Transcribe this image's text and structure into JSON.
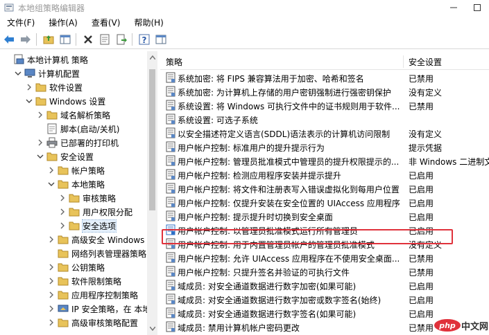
{
  "window": {
    "title": "本地组策略编辑器"
  },
  "menu": [
    "文件(F)",
    "操作(A)",
    "查看(V)",
    "帮助(H)"
  ],
  "toolbar_icons": [
    "back-arrow-icon",
    "forward-arrow-icon",
    "up-folder-icon",
    "show-tree-icon",
    "delete-icon",
    "properties-icon",
    "export-icon",
    "help-icon",
    "show-hide-pane-icon"
  ],
  "tree": [
    {
      "label": "本地计算机 策略",
      "icon": "policy-computer-icon",
      "level": 0,
      "expanded": null
    },
    {
      "label": "计算机配置",
      "icon": "computer-icon",
      "level": 1,
      "expanded": true
    },
    {
      "label": "软件设置",
      "icon": "folder-icon",
      "level": 2,
      "expanded": false
    },
    {
      "label": "Windows 设置",
      "icon": "folder-icon",
      "level": 2,
      "expanded": true
    },
    {
      "label": "域名解析策略",
      "icon": "folder-icon",
      "level": 3,
      "expanded": false
    },
    {
      "label": "脚本(启动/关机)",
      "icon": "script-icon",
      "level": 3,
      "expanded": null
    },
    {
      "label": "已部署的打印机",
      "icon": "printer-icon",
      "level": 3,
      "expanded": false
    },
    {
      "label": "安全设置",
      "icon": "folder-icon",
      "level": 3,
      "expanded": true
    },
    {
      "label": "帐户策略",
      "icon": "folder-icon",
      "level": 4,
      "expanded": false
    },
    {
      "label": "本地策略",
      "icon": "folder-icon",
      "level": 4,
      "expanded": true
    },
    {
      "label": "审核策略",
      "icon": "folder-icon",
      "level": 5,
      "expanded": false
    },
    {
      "label": "用户权限分配",
      "icon": "folder-icon",
      "level": 5,
      "expanded": false
    },
    {
      "label": "安全选项",
      "icon": "folder-icon",
      "level": 5,
      "expanded": false,
      "selected": true
    },
    {
      "label": "高级安全 Windows",
      "icon": "folder-icon",
      "level": 4,
      "expanded": false
    },
    {
      "label": "网络列表管理器策略",
      "icon": "folder-icon",
      "level": 4,
      "expanded": null
    },
    {
      "label": "公钥策略",
      "icon": "folder-icon",
      "level": 4,
      "expanded": false
    },
    {
      "label": "软件限制策略",
      "icon": "folder-icon",
      "level": 4,
      "expanded": false
    },
    {
      "label": "应用程序控制策略",
      "icon": "folder-icon",
      "level": 4,
      "expanded": false
    },
    {
      "label": "IP 安全策略，在 本地",
      "icon": "ip-security-icon",
      "level": 4,
      "expanded": false
    },
    {
      "label": "高级审核策略配置",
      "icon": "folder-icon",
      "level": 4,
      "expanded": false
    }
  ],
  "list": {
    "headers": {
      "policy": "策略",
      "setting": "安全设置"
    },
    "rows": [
      {
        "name": "系统加密: 将 FIPS 兼容算法用于加密、哈希和签名",
        "value": "已禁用"
      },
      {
        "name": "系统加密: 为计算机上存储的用户密钥强制进行强密钥保护",
        "value": "没有定义"
      },
      {
        "name": "系统设置: 将 Windows 可执行文件中的证书规则用于软件...",
        "value": "已禁用"
      },
      {
        "name": "系统设置: 可选子系统",
        "value": ""
      },
      {
        "name": "以安全描述符定义语言(SDDL)语法表示的计算机访问限制",
        "value": "没有定义"
      },
      {
        "name": "用户帐户控制: 标准用户的提升提示行为",
        "value": "提示凭据"
      },
      {
        "name": "用户帐户控制: 管理员批准模式中管理员的提升权限提示的...",
        "value": "非 Windows 二进制文"
      },
      {
        "name": "用户帐户控制: 检测应用程序安装并提示提升",
        "value": "已启用"
      },
      {
        "name": "用户帐户控制: 将文件和注册表写入错误虚拟化到每用户位置",
        "value": "已启用"
      },
      {
        "name": "用户帐户控制: 仅提升安装在安全位置的 UIAccess 应用程序",
        "value": "已启用"
      },
      {
        "name": "用户帐户控制: 提示提升时切换到安全桌面",
        "value": "已启用"
      },
      {
        "name": "用户帐户控制: 以管理员批准模式运行所有管理员",
        "value": "已启用",
        "highlighted": true
      },
      {
        "name": "用户帐户控制: 用于内置管理员帐户的管理员批准模式",
        "value": "没有定义"
      },
      {
        "name": "用户帐户控制: 允许 UIAccess 应用程序在不使用安全桌面...",
        "value": "已禁用"
      },
      {
        "name": "用户帐户控制: 只提升签名并验证的可执行文件",
        "value": "已禁用"
      },
      {
        "name": "域成员: 对安全通道数据进行数字加密(如果可能)",
        "value": "已启用"
      },
      {
        "name": "域成员: 对安全通道数据进行数字加密或数字签名(始终)",
        "value": "已启用"
      },
      {
        "name": "域成员: 对安全通道数据进行数字签名(如果可能)",
        "value": "已启用"
      },
      {
        "name": "域成员: 禁用计算机帐户密码更改",
        "value": "已禁用"
      }
    ]
  },
  "watermark": {
    "text": "中文网",
    "logo": "php-logo"
  },
  "colors": {
    "highlight_border": "#e0313b",
    "selected_bg": "#e5f0fb",
    "folder": "#e8c35a"
  }
}
